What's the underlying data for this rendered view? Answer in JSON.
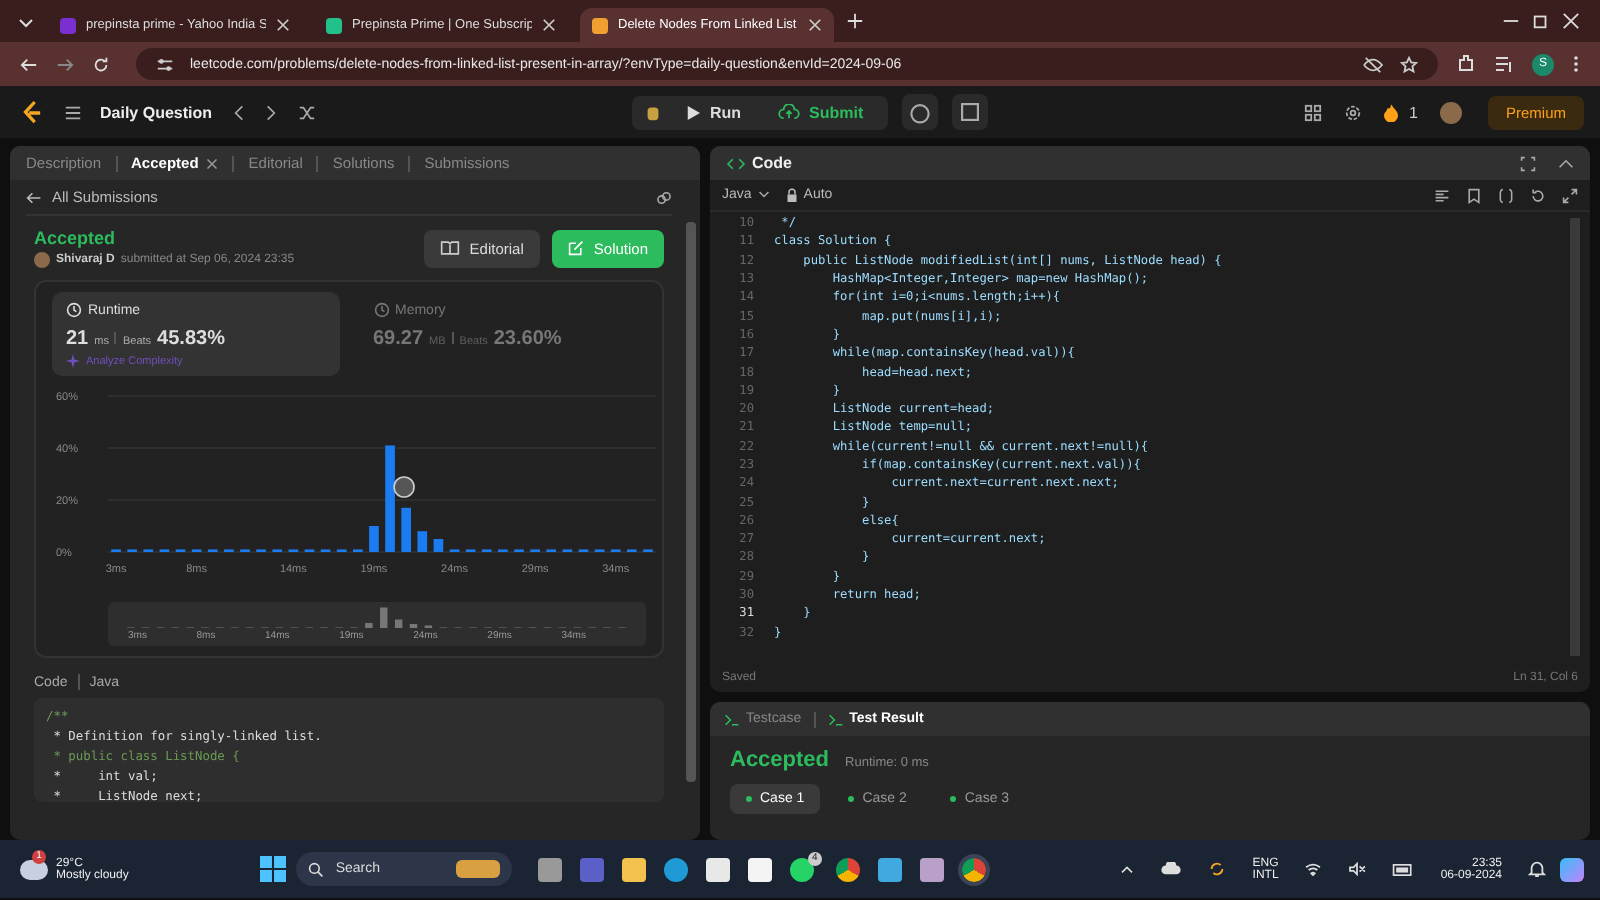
{
  "browser": {
    "tabs": [
      {
        "title": "prepinsta prime - Yahoo India S",
        "selected": false,
        "color": "#7b2fd0"
      },
      {
        "title": "Prepinsta Prime | One Subscrip",
        "selected": false,
        "color": "#22c08a"
      },
      {
        "title": "Delete Nodes From Linked List",
        "selected": true,
        "color": "#f0a030"
      }
    ],
    "url": "leetcode.com/problems/delete-nodes-from-linked-list-present-in-array/?envType=daily-question&envId=2024-09-06",
    "profile": "S"
  },
  "nav": {
    "title": "Daily Question",
    "run": "Run",
    "submit": "Submit",
    "streak": "1",
    "premium": "Premium"
  },
  "left": {
    "tabs": [
      {
        "label": "Description",
        "selected": false,
        "closable": false
      },
      {
        "label": "Accepted",
        "selected": true,
        "closable": true
      },
      {
        "label": "Editorial",
        "selected": false,
        "closable": false
      },
      {
        "label": "Solutions",
        "selected": false,
        "closable": false
      },
      {
        "label": "Submissions",
        "selected": false,
        "closable": false
      }
    ],
    "back": "All Submissions",
    "result": {
      "status": "Accepted",
      "author": "Shivaraj D",
      "submitted": "submitted at Sep 06, 2024 23:35",
      "editorial_button": "Editorial",
      "solution_button": "Solution"
    },
    "stats": [
      {
        "label": "Runtime",
        "value": "21",
        "unit": "ms",
        "beats_label": "Beats",
        "beats": "45.83%",
        "analyze": "Analyze Complexity",
        "selected": true
      },
      {
        "label": "Memory",
        "value": "69.27",
        "unit": "MB",
        "beats_label": "Beats",
        "beats": "23.60%",
        "selected": false
      }
    ],
    "chart_data": {
      "type": "bar",
      "xlim": [
        2.5,
        36.5
      ],
      "x": [
        3,
        4,
        5,
        6,
        7,
        8,
        9,
        10,
        11,
        12,
        13,
        14,
        15,
        16,
        17,
        18,
        19,
        20,
        21,
        22,
        23,
        24,
        25,
        26,
        27,
        28,
        29,
        30,
        31,
        32,
        33,
        34,
        35,
        36
      ],
      "series": [
        {
          "color": "#1a7cf0",
          "values": [
            1,
            1,
            1,
            1,
            1,
            1,
            1,
            1,
            1,
            1,
            1,
            1,
            1,
            1,
            1,
            1,
            10,
            41,
            17,
            8,
            5,
            1,
            1,
            1,
            1,
            1,
            1,
            1,
            1,
            1,
            1,
            1,
            1,
            1
          ]
        }
      ],
      "ylim": [
        0,
        60
      ],
      "yticks": [
        {
          "value": 0,
          "label": "0%"
        },
        {
          "value": 20,
          "label": "20%"
        },
        {
          "value": 40,
          "label": "40%"
        },
        {
          "value": 60,
          "label": "60%"
        }
      ],
      "xticks": [
        {
          "value": 3,
          "label": "3ms"
        },
        {
          "value": 8,
          "label": "8ms"
        },
        {
          "value": 14,
          "label": "14ms"
        },
        {
          "value": 19,
          "label": "19ms"
        },
        {
          "value": 24,
          "label": "24ms"
        },
        {
          "value": 29,
          "label": "29ms"
        },
        {
          "value": 34,
          "label": "34ms"
        }
      ]
    },
    "overview_labels": [
      "3ms",
      "8ms",
      "14ms",
      "19ms",
      "24ms",
      "29ms",
      "34ms"
    ],
    "code": {
      "title": "Code",
      "language": "Java",
      "lines": [
        "/**",
        " * Definition for singly-linked list.",
        " * public class ListNode {",
        " *     int val;",
        " *     ListNode next;"
      ]
    }
  },
  "editor": {
    "title": "Code",
    "language": "Java",
    "mode": "Auto",
    "lines": [
      {
        "number": "10",
        "text": " */",
        "current": false
      },
      {
        "number": "11",
        "text": "class Solution {",
        "current": false
      },
      {
        "number": "12",
        "text": "    public ListNode modifiedList(int[] nums, ListNode head) {",
        "current": false
      },
      {
        "number": "13",
        "text": "        HashMap<Integer,Integer> map=new HashMap();",
        "current": false
      },
      {
        "number": "14",
        "text": "        for(int i=0;i<nums.length;i++){",
        "current": false
      },
      {
        "number": "15",
        "text": "            map.put(nums[i],i);",
        "current": false
      },
      {
        "number": "16",
        "text": "        }",
        "current": false
      },
      {
        "number": "17",
        "text": "        while(map.containsKey(head.val)){",
        "current": false
      },
      {
        "number": "18",
        "text": "            head=head.next;",
        "current": false
      },
      {
        "number": "19",
        "text": "        }",
        "current": false
      },
      {
        "number": "20",
        "text": "        ListNode current=head;",
        "current": false
      },
      {
        "number": "21",
        "text": "        ListNode temp=null;",
        "current": false
      },
      {
        "number": "22",
        "text": "        while(current!=null && current.next!=null){",
        "current": false
      },
      {
        "number": "23",
        "text": "            if(map.containsKey(current.next.val)){",
        "current": false
      },
      {
        "number": "24",
        "text": "                current.next=current.next.next;",
        "current": false
      },
      {
        "number": "25",
        "text": "            }",
        "current": false
      },
      {
        "number": "26",
        "text": "            else{",
        "current": false
      },
      {
        "number": "27",
        "text": "                current=current.next;",
        "current": false
      },
      {
        "number": "28",
        "text": "            }",
        "current": false
      },
      {
        "number": "29",
        "text": "        }",
        "current": false
      },
      {
        "number": "30",
        "text": "        return head;",
        "current": false
      },
      {
        "number": "31",
        "text": "    }",
        "current": true
      },
      {
        "number": "32",
        "text": "}",
        "current": false
      }
    ],
    "status_left": "Saved",
    "status_right": "Ln 31, Col 6"
  },
  "test": {
    "tabs": [
      {
        "label": "Testcase",
        "selected": false
      },
      {
        "label": "Test Result",
        "selected": true
      }
    ],
    "status": "Accepted",
    "runtime": "Runtime: 0 ms",
    "cases": [
      {
        "label": "Case 1",
        "selected": true
      },
      {
        "label": "Case 2",
        "selected": false
      },
      {
        "label": "Case 3",
        "selected": false
      }
    ]
  },
  "taskbar": {
    "weather_badge": "1",
    "temperature": "29°C",
    "weather": "Mostly cloudy",
    "search": "Search",
    "chat_badge": "4",
    "language": "ENG",
    "layout": "INTL",
    "time": "23:35",
    "date": "06-09-2024"
  }
}
